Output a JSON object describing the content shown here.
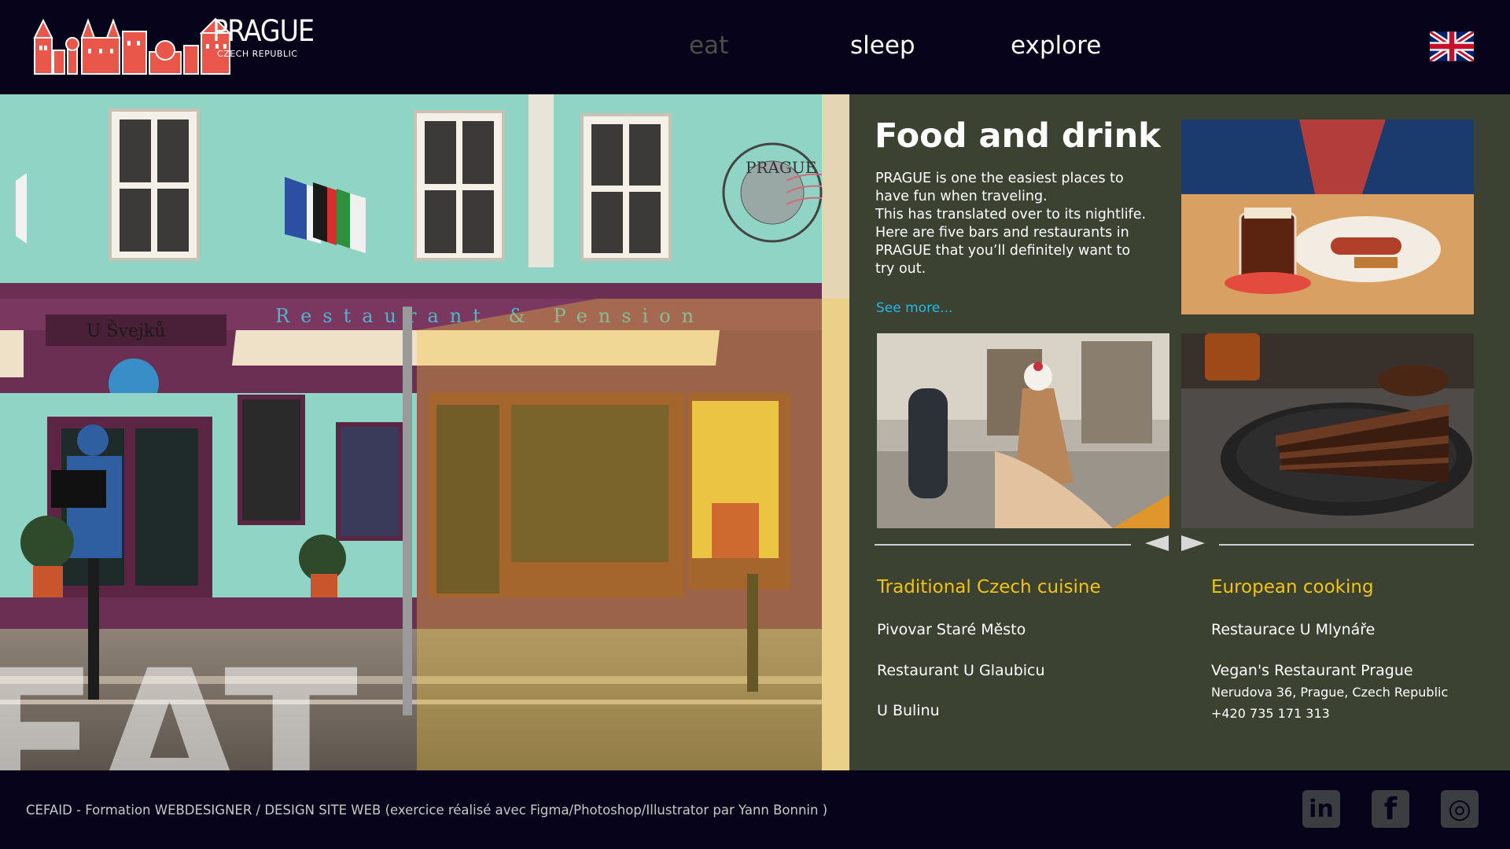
{
  "header": {
    "logo_title": "PRAGUE",
    "logo_subtitle": "CZECH REPUBLIC",
    "nav": [
      {
        "label": "eat",
        "active": true
      },
      {
        "label": "sleep",
        "active": false
      },
      {
        "label": "explore",
        "active": false
      }
    ],
    "language_icon": "uk-flag-icon"
  },
  "hero": {
    "overlay_word": "EAT",
    "sign_text": "U Švejků",
    "banner_text": "Restaurant & Pension",
    "stamp_text": "PRAGUE"
  },
  "panel": {
    "title": "Food and drink",
    "intro_lines": [
      "PRAGUE is one the easiest places to",
      "have fun when traveling.",
      "This has translated over to its nightlife.",
      "Here are five bars and restaurants in",
      "PRAGUE that you’ll definitely want to",
      "try out."
    ],
    "see_more": "See more...",
    "categories": [
      {
        "title": "Traditional Czech cuisine",
        "restaurants": [
          "Pivovar Staré Město",
          "Restaurant U Glaubicu",
          "U Bulinu"
        ]
      },
      {
        "title": "European cooking",
        "restaurants": [
          "Restaurace U Mlynáře",
          "Vegan's Restaurant Prague"
        ],
        "address": "Nerudova 36, Prague, Czech Republic",
        "phone": "+420 735 171 313"
      }
    ]
  },
  "footer": {
    "credit": "CEFAID - Formation WEBDESIGNER / DESIGN SITE WEB (exercice réalisé avec Figma/Photoshop/Illustrator par Yann Bonnin )",
    "social_icons": [
      "linkedin-icon",
      "facebook-icon",
      "instagram-icon"
    ],
    "social_labels": [
      "in",
      "f",
      "◎"
    ]
  },
  "colors": {
    "background": "#06031a",
    "panel": "#3b4232",
    "accent_yellow": "#f2c40d",
    "link_blue": "#23b8ea",
    "nav_active": "#4a4e45"
  }
}
